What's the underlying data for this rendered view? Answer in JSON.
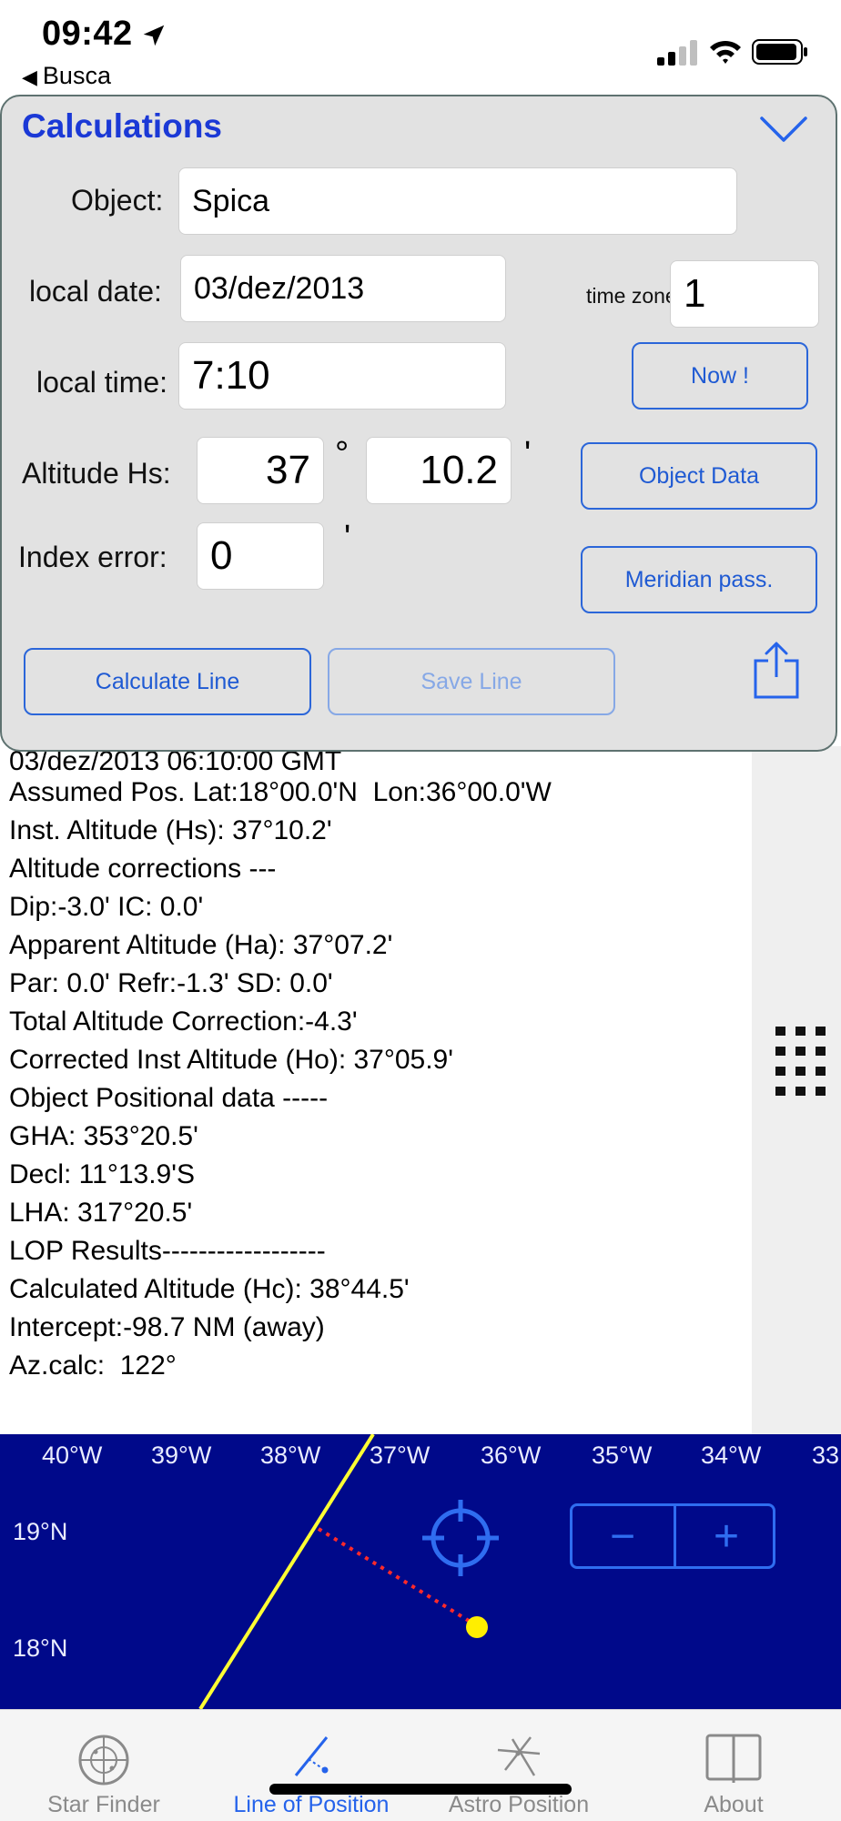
{
  "status": {
    "time": "09:42",
    "back_label": "Busca"
  },
  "panel": {
    "title": "Calculations",
    "object_label": "Object:",
    "object_value": "Spica",
    "date_label": "local date:",
    "date_value": "03/dez/2013",
    "tz_label": "time zone:",
    "tz_value": "1",
    "time_label": "local time:",
    "time_value": "7:10",
    "now_button": "Now !",
    "altitude_label": "Altitude Hs:",
    "altitude_deg": "37",
    "deg_symbol": "°",
    "altitude_min": "10.2",
    "min_symbol": "'",
    "object_data_button": "Object Data",
    "index_label": "Index error:",
    "index_value": "0",
    "meridian_button": "Meridian pass.",
    "calc_button": "Calculate Line",
    "save_button": "Save Line"
  },
  "results": {
    "lines": [
      "03/dez/2013 06:10:00 GMT",
      "Assumed Pos. Lat:18°00.0'N  Lon:36°00.0'W",
      "Inst. Altitude (Hs): 37°10.2'",
      "Altitude corrections ---",
      "Dip:-3.0' IC: 0.0'",
      "Apparent Altitude (Ha): 37°07.2'",
      "Par: 0.0' Refr:-1.3' SD: 0.0'",
      "Total Altitude Correction:-4.3'",
      "Corrected Inst Altitude (Ho): 37°05.9'",
      "Object Positional data -----",
      "GHA: 353°20.5'",
      "Decl: 11°13.9'S",
      "LHA: 317°20.5'",
      "LOP Results------------------",
      "Calculated Altitude (Hc): 38°44.5'",
      "Intercept:-98.7 NM (away)",
      "Az.calc:  122°"
    ]
  },
  "map": {
    "lon_labels": [
      "40°W",
      "39°W",
      "38°W",
      "37°W",
      "36°W",
      "35°W",
      "34°W",
      "33"
    ],
    "lat_labels": [
      "19°N",
      "18°N"
    ],
    "zoom_out": "−",
    "zoom_in": "+",
    "colors": {
      "background": "#00098a",
      "lop_line": "#ffff33",
      "intercept": "#ff2a2a",
      "position": "#ffee00",
      "control": "#2f6df0"
    }
  },
  "tabs": [
    {
      "label": "Star Finder",
      "icon": "star-finder-icon",
      "active": false
    },
    {
      "label": "Line of Position",
      "icon": "line-of-position-icon",
      "active": true
    },
    {
      "label": "Astro Position",
      "icon": "astro-position-icon",
      "active": false
    },
    {
      "label": "About",
      "icon": "book-icon",
      "active": false
    }
  ]
}
